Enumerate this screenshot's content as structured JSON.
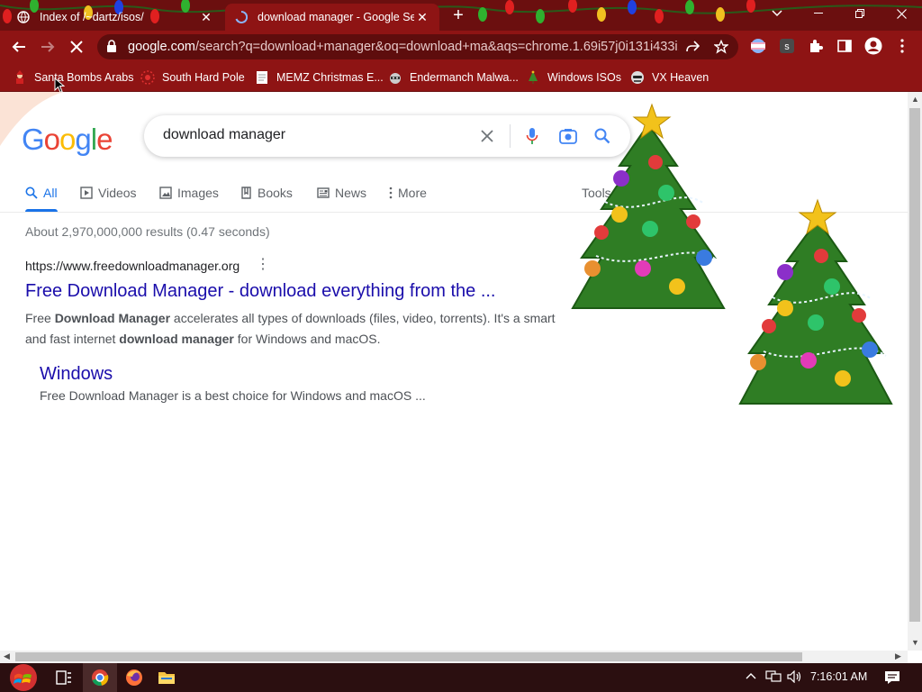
{
  "browser": {
    "tabs": [
      {
        "title": "Index of /~dartz/isos/",
        "active": false
      },
      {
        "title": "download manager - Google Sea",
        "active": true
      }
    ],
    "url_host": "google.com",
    "url_rest": "/search?q=download+manager&oq=download+ma&aqs=chrome.1.69i57j0i131i433i..."
  },
  "bookmarks": [
    {
      "label": "Santa Bombs Arabs",
      "icon": "santa-icon"
    },
    {
      "label": "South Hard Pole",
      "icon": "red-star-icon"
    },
    {
      "label": "MEMZ Christmas E...",
      "icon": "page-icon"
    },
    {
      "label": "Endermanch Malwa...",
      "icon": "raccoon-icon"
    },
    {
      "label": "Windows ISOs",
      "icon": "tree-icon"
    },
    {
      "label": "VX Heaven",
      "icon": "spy-icon"
    }
  ],
  "google": {
    "logo_letters": [
      "G",
      "o",
      "o",
      "g",
      "l",
      "e"
    ],
    "query": "download manager",
    "tabs": [
      "All",
      "Videos",
      "Images",
      "Books",
      "News",
      "More"
    ],
    "tools": "Tools",
    "stats": "About 2,970,000,000 results (0.47 seconds)",
    "result": {
      "cite": "https://www.freedownloadmanager.org",
      "title": "Free Download Manager - download everything from the ...",
      "snippet_parts": [
        {
          "t": "Free ",
          "b": false
        },
        {
          "t": "Download Manager",
          "b": true
        },
        {
          "t": " accelerates all types of downloads (files, video, torrents). It's a smart and fast internet ",
          "b": false
        },
        {
          "t": "download manager",
          "b": true
        },
        {
          "t": " for Windows and macOS.",
          "b": false
        }
      ],
      "sublink_title": "Windows",
      "sublink_snippet": "Free Download Manager is a best choice for Windows and macOS ..."
    }
  },
  "taskbar": {
    "clock": "7:16:01 AM",
    "apps": [
      "start-orb-icon",
      "task-view-icon",
      "chrome-icon",
      "firefox-icon",
      "file-explorer-icon"
    ]
  },
  "colors": {
    "chrome_dark": "#6b0f0f",
    "chrome": "#8e1414",
    "link": "#1a0dab",
    "accent": "#1a73e8"
  }
}
